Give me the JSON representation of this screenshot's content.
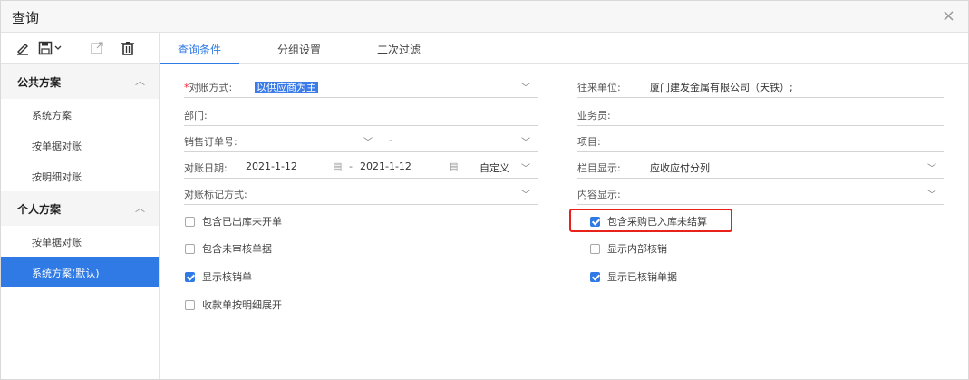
{
  "window": {
    "title": "查询",
    "close_glyph": "×"
  },
  "toolbar": {
    "icons": [
      "edit-icon",
      "save-icon",
      "export-icon",
      "delete-icon"
    ]
  },
  "sidebar": {
    "public": {
      "label": "公共方案",
      "items": [
        "系统方案",
        "按单据对账",
        "按明细对账"
      ]
    },
    "personal": {
      "label": "个人方案",
      "items": [
        "按单据对账",
        "系统方案(默认)"
      ]
    }
  },
  "tabs": [
    "查询条件",
    "分组设置",
    "二次过滤"
  ],
  "form": {
    "match_method": {
      "required_mark": "*",
      "label": "对账方式:",
      "value": "以供应商为主"
    },
    "dept": {
      "label": "部门:"
    },
    "sales_order": {
      "label": "销售订单号:",
      "dash": "-"
    },
    "recon_date": {
      "label": "对账日期:",
      "from": "2021-1-12",
      "sep": "-",
      "to": "2021-1-12",
      "custom": "自定义"
    },
    "mark_method": {
      "label": "对账标记方式:"
    },
    "partner": {
      "label": "往来单位:",
      "value": "厦门建发金属有限公司（天铁）;"
    },
    "salesman": {
      "label": "业务员:"
    },
    "project": {
      "label": "项目:"
    },
    "column_display": {
      "label": "栏目显示:",
      "value": "应收应付分列"
    },
    "content_display": {
      "label": "内容显示:"
    }
  },
  "checks_left": [
    {
      "label": "包含已出库未开单",
      "checked": false
    },
    {
      "label": "包含未审核单据",
      "checked": false
    },
    {
      "label": "显示核销单",
      "checked": true
    },
    {
      "label": "收款单按明细展开",
      "checked": false
    }
  ],
  "checks_right": [
    {
      "label": "包含采购已入库未结算",
      "checked": true
    },
    {
      "label": "显示内部核销",
      "checked": false
    },
    {
      "label": "显示已核销单据",
      "checked": true
    }
  ],
  "colors": {
    "accent": "#2f7ae5",
    "highlight_border": "#e8211b"
  }
}
